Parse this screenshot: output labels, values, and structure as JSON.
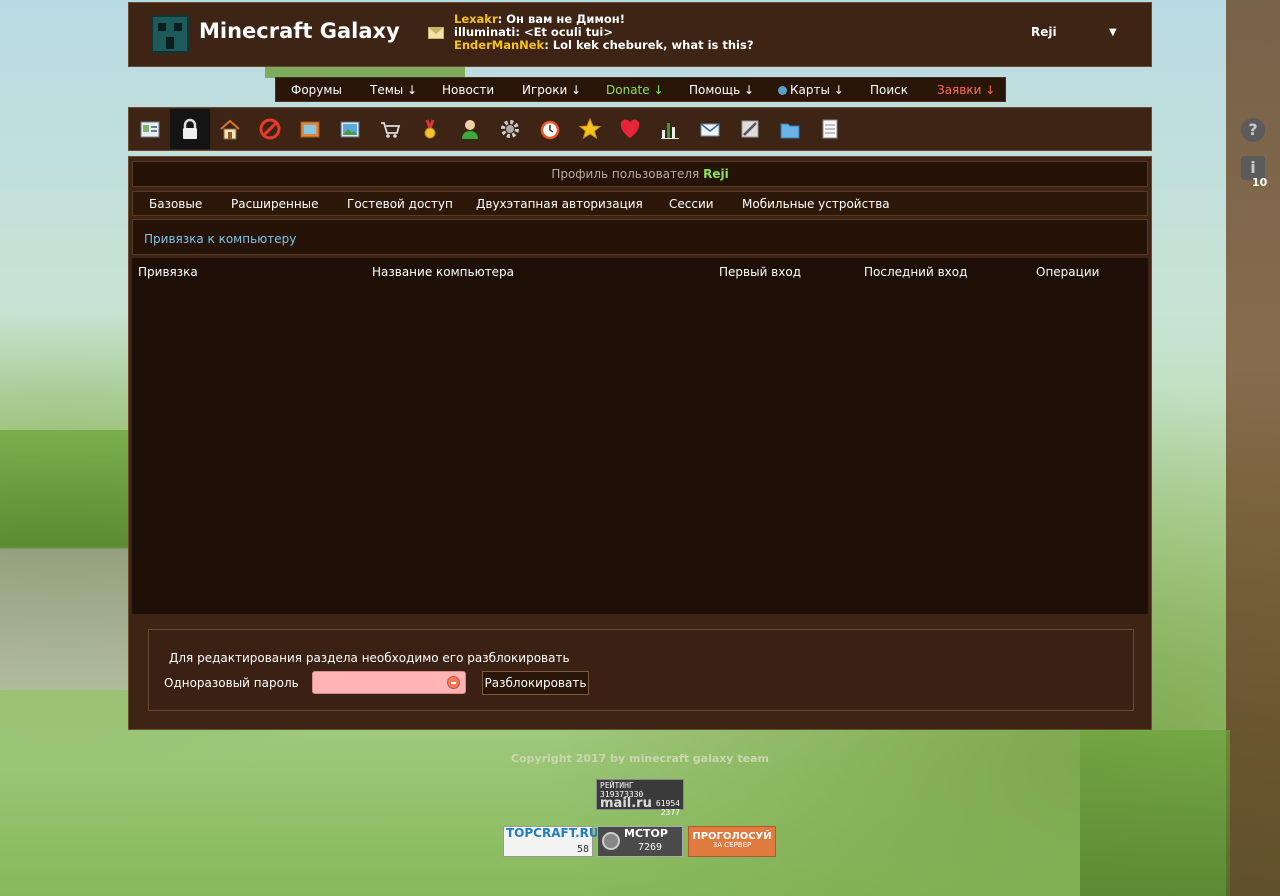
{
  "site": {
    "title": "Minecraft Galaxy"
  },
  "chat": [
    {
      "nick": "Lexakr",
      "sep": ":",
      "text": " Он вам не Димон!",
      "nick_color": "#f7c21a"
    },
    {
      "nick": "illuminati",
      "sep": ":",
      "text": " <Et oculi tui>",
      "nick_color": "#ffffff"
    },
    {
      "nick": "EnderManNek",
      "sep": ":",
      "text": " Lol kek cheburek, what is this?",
      "nick_color": "#f7c21a"
    }
  ],
  "user": {
    "name": "Reji",
    "caret": "▼"
  },
  "nav": [
    {
      "label": "Форумы",
      "style": "normal"
    },
    {
      "label": "Темы ↓",
      "style": "normal"
    },
    {
      "label": "Новости",
      "style": "normal"
    },
    {
      "label": "Игроки ↓",
      "style": "normal"
    },
    {
      "label": "Donate ↓",
      "style": "green"
    },
    {
      "label": "Помощь ↓",
      "style": "normal"
    },
    {
      "label": "Карты ↓",
      "style": "normal",
      "icon": "globe-icon"
    },
    {
      "label": "Поиск",
      "style": "normal"
    },
    {
      "label": "Заявки ↓",
      "style": "red"
    }
  ],
  "toolbar": [
    {
      "icon": "profile-card-icon",
      "active": false
    },
    {
      "icon": "lock-icon",
      "active": true
    },
    {
      "icon": "home-icon",
      "active": false
    },
    {
      "icon": "block-icon",
      "active": false
    },
    {
      "icon": "picture-frame-icon",
      "active": false
    },
    {
      "icon": "landscape-image-icon",
      "active": false
    },
    {
      "icon": "shopping-cart-icon",
      "active": false
    },
    {
      "icon": "medal-icon",
      "active": false
    },
    {
      "icon": "user-icon",
      "active": false
    },
    {
      "icon": "gear-icon",
      "active": false
    },
    {
      "icon": "alarm-clock-icon",
      "active": false
    },
    {
      "icon": "star-icon",
      "active": false
    },
    {
      "icon": "heart-icon",
      "active": false
    },
    {
      "icon": "bar-chart-icon",
      "active": false
    },
    {
      "icon": "mail-icon",
      "active": false
    },
    {
      "icon": "tools-icon",
      "active": false
    },
    {
      "icon": "folder-icon",
      "active": false
    },
    {
      "icon": "notepad-icon",
      "active": false
    }
  ],
  "profile": {
    "title_prefix": "Профиль пользователя",
    "username": "Reji"
  },
  "subtabs": [
    "Базовые",
    "Расширенные",
    "Гостевой доступ",
    "Двухэтапная авторизация",
    "Сессии",
    "Мобильные устройства"
  ],
  "section": {
    "link": "Привязка к компьютеру"
  },
  "table": {
    "headers": [
      "Привязка",
      "Название компьютера",
      "Первый вход",
      "Последний вход",
      "Операции"
    ]
  },
  "lock": {
    "message": "Для редактирования раздела необходимо его разблокировать",
    "password_label": "Одноразовый пароль",
    "password_value": "",
    "unlock_label": "Разблокировать"
  },
  "side": {
    "help": "?",
    "info": "i",
    "badge": "10"
  },
  "footer": {
    "copyright": "Copyright 2017 by minecraft galaxy team",
    "mail_counter": {
      "line1": "РЕЙТИНГ 319373330",
      "brand": "mail.ru",
      "n1": "61954",
      "n2": "2377"
    },
    "topcraft": {
      "brand": "TOPCRAFT.RU",
      "num": "58"
    },
    "mctop": {
      "brand": "MCTOP",
      "num": "7269"
    },
    "vote": {
      "l1": "ПРОГОЛОСУЙ",
      "l2": "ЗА СЕРВЕР"
    }
  },
  "colors": {
    "panel": "#3d2414",
    "accent_green": "#8ee05a",
    "accent_red": "#ff6b5a",
    "link": "#7fc3e8"
  }
}
